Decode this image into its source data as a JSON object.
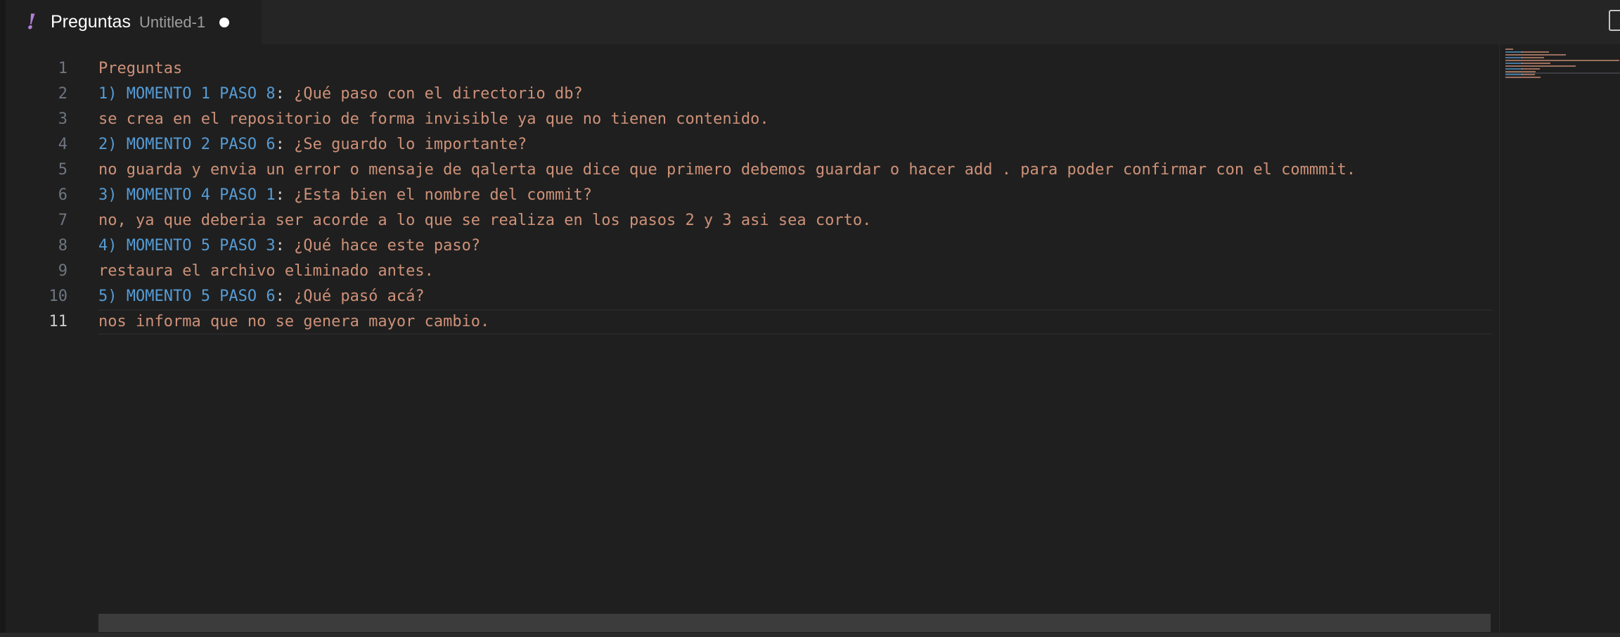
{
  "tab": {
    "title": "Preguntas",
    "description": "Untitled-1",
    "icon": "yaml-exclamation-icon",
    "dirty": true
  },
  "editor": {
    "active_line": 11,
    "lines": [
      {
        "number": "1",
        "parts": [
          {
            "type": "text",
            "value": "Preguntas"
          }
        ]
      },
      {
        "number": "2",
        "parts": [
          {
            "type": "num",
            "value": "1) MOMENTO 1 PASO 8"
          },
          {
            "type": "colon",
            "value": ":"
          },
          {
            "type": "text",
            "value": " ¿Qué paso con el directorio db?"
          }
        ]
      },
      {
        "number": "3",
        "parts": [
          {
            "type": "text",
            "value": "se crea en el repositorio de forma invisible ya que no tienen contenido."
          }
        ]
      },
      {
        "number": "4",
        "parts": [
          {
            "type": "num",
            "value": "2) MOMENTO 2 PASO 6"
          },
          {
            "type": "colon",
            "value": ":"
          },
          {
            "type": "text",
            "value": " ¿Se guardo lo importante?"
          }
        ]
      },
      {
        "number": "5",
        "parts": [
          {
            "type": "text",
            "value": "no guarda y envia un error o mensaje de qalerta que dice que primero debemos guardar o hacer add . para poder confirmar con el commmit."
          }
        ]
      },
      {
        "number": "6",
        "parts": [
          {
            "type": "num",
            "value": "3) MOMENTO 4 PASO 1"
          },
          {
            "type": "colon",
            "value": ":"
          },
          {
            "type": "text",
            "value": " ¿Esta bien el nombre del commit?"
          }
        ]
      },
      {
        "number": "7",
        "parts": [
          {
            "type": "text",
            "value": "no, ya que deberia ser acorde a lo que se realiza en los pasos 2 y 3 asi sea corto."
          }
        ]
      },
      {
        "number": "8",
        "parts": [
          {
            "type": "num",
            "value": "4) MOMENTO 5 PASO 3"
          },
          {
            "type": "colon",
            "value": ":"
          },
          {
            "type": "text",
            "value": " ¿Qué hace este paso?"
          }
        ]
      },
      {
        "number": "9",
        "parts": [
          {
            "type": "text",
            "value": "restaura el archivo eliminado antes."
          }
        ]
      },
      {
        "number": "10",
        "parts": [
          {
            "type": "num",
            "value": "5) MOMENTO 5 PASO 6"
          },
          {
            "type": "colon",
            "value": ":"
          },
          {
            "type": "text",
            "value": " ¿Qué pasó acá?"
          }
        ]
      },
      {
        "number": "11",
        "parts": [
          {
            "type": "text",
            "value": "nos informa que no se genera mayor cambio."
          }
        ]
      }
    ]
  },
  "colors": {
    "string": "#ce9178",
    "keyword": "#569cd6",
    "punctuation": "#d4d4d4",
    "background": "#1f1f1f",
    "icon_accent": "#b180d7"
  }
}
